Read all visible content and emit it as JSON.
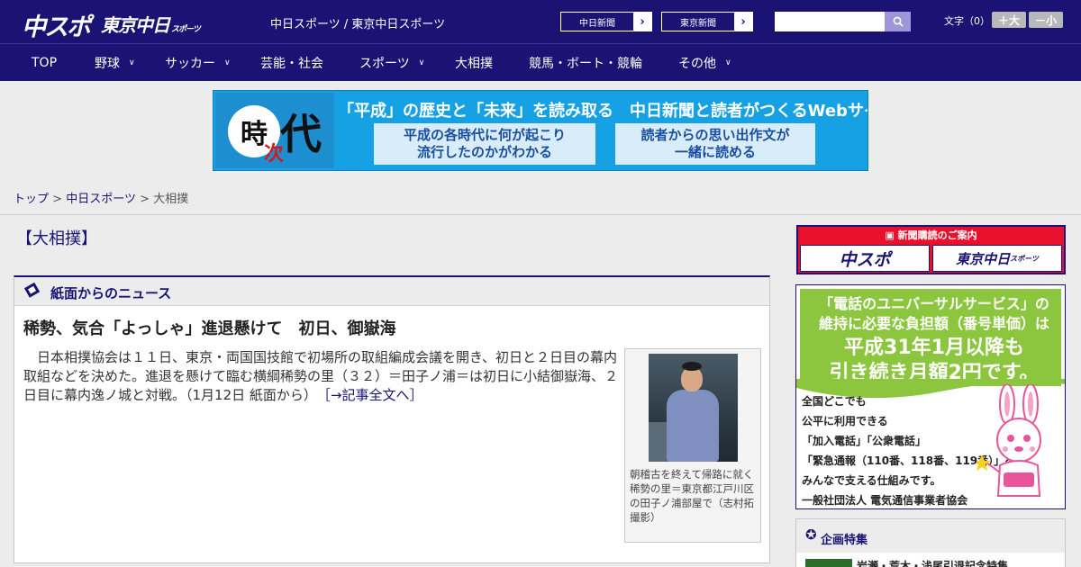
{
  "header": {
    "logo_main": "中スポ",
    "logo_tokyo": "東京中日",
    "logo_tokyo_sub": "スポーツ",
    "site_title": "中日スポーツ / 東京中日スポーツ",
    "links": [
      {
        "label": "中日新聞"
      },
      {
        "label": "東京新聞"
      }
    ],
    "search": {
      "value": "",
      "placeholder": ""
    },
    "font_size": {
      "label": "文字（0）",
      "increase": "＋大",
      "decrease": "－小"
    }
  },
  "nav": {
    "items": [
      {
        "label": "TOP"
      },
      {
        "label": "野球"
      },
      {
        "label": "サッカー"
      },
      {
        "label": "芸能・社会"
      },
      {
        "label": "スポーツ"
      },
      {
        "label": "大相撲"
      },
      {
        "label": "競馬・ボート・競輪"
      },
      {
        "label": "その他"
      }
    ]
  },
  "banner": {
    "ji": "時",
    "dai": "代",
    "tsugi": "次",
    "headline": "「平成」の歴史と「未来」を読み取る　中日新聞と読者がつくるWebサイト",
    "box1_line1": "平成の各時代に何が起こり",
    "box1_line2": "流行したのかがわかる",
    "box2_line1": "読者からの思い出作文が",
    "box2_line2": "一緒に読める"
  },
  "breadcrumb": {
    "items": [
      {
        "label": "トップ"
      },
      {
        "label": "中日スポーツ"
      }
    ],
    "sep": ">",
    "current": "大相撲"
  },
  "main": {
    "page_title": "【大相撲】",
    "section_title": "紙面からのニュース",
    "article": {
      "title": "稀勢、気合「よっしゃ」進退懸けて　初日、御嶽海",
      "body": "日本相撲協会は１１日、東京・両国国技館で初場所の取組編成会議を開き、初日と２日目の幕内取組などを決めた。進退を懸けて臨む横綱稀勢の里（３２）＝田子ノ浦＝は初日に小結御嶽海、２日目に幕内逸ノ城と対戦。（1月12日 紙面から）",
      "more_link": "［→記事全文へ］",
      "photo_caption": "朝稽古を終えて帰路に就く稀勢の里＝東京都江戸川区の田子ノ浦部屋で（志村拓撮影）"
    }
  },
  "sidebar": {
    "subscription": {
      "label": "新聞購読のご案内",
      "tile1": "中スポ",
      "tile2": "東京中日",
      "tile2_sub": "スポーツ"
    },
    "ad": {
      "line1": "「電話のユニバーサルサービス」の",
      "line2": "維持に必要な負担額（番号単価）は",
      "line3": "平成31年1月以降も",
      "line4": "引き続き月額2円です。",
      "body1": "全国どこでも",
      "body2": "公平に利用できる",
      "body3": "「加入電話」「公衆電話」",
      "body4": "「緊急通報（110番、118番、119番）」を",
      "body5": "みんなで支える仕組みです。",
      "sponsor": "一般社団法人 電気通信事業者協会"
    },
    "feature": {
      "title": "企画特集",
      "item": "岩瀬・荒木・浅尾引退記念特集"
    }
  },
  "colors": {
    "brand_navy": "#1a1373",
    "ad_green": "#8cc63e",
    "subscription_red": "#e8112d",
    "banner_blue": "#15a1e3"
  }
}
